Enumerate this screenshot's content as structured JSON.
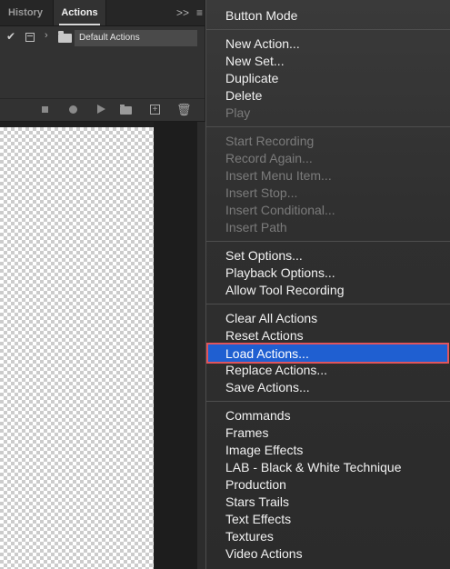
{
  "panel": {
    "tabs": [
      {
        "label": "History"
      },
      {
        "label": "Actions"
      }
    ],
    "collapse_glyph": ">>",
    "menu_glyph": "≡",
    "action_set": {
      "checked": "✔",
      "name": "Default Actions"
    },
    "toolbar_icons": [
      "stop-icon",
      "record-icon",
      "play-icon",
      "folder-icon",
      "new-action-icon",
      "trash-icon"
    ]
  },
  "menu": {
    "groups": [
      {
        "items": [
          {
            "label": "Button Mode",
            "enabled": true
          }
        ]
      },
      {
        "items": [
          {
            "label": "New Action...",
            "enabled": true
          },
          {
            "label": "New Set...",
            "enabled": true
          },
          {
            "label": "Duplicate",
            "enabled": true
          },
          {
            "label": "Delete",
            "enabled": true
          },
          {
            "label": "Play",
            "enabled": false
          }
        ]
      },
      {
        "items": [
          {
            "label": "Start Recording",
            "enabled": false
          },
          {
            "label": "Record Again...",
            "enabled": false
          },
          {
            "label": "Insert Menu Item...",
            "enabled": false
          },
          {
            "label": "Insert Stop...",
            "enabled": false
          },
          {
            "label": "Insert Conditional...",
            "enabled": false
          },
          {
            "label": "Insert Path",
            "enabled": false
          }
        ]
      },
      {
        "items": [
          {
            "label": "Set Options...",
            "enabled": true
          },
          {
            "label": "Playback Options...",
            "enabled": true
          },
          {
            "label": "Allow Tool Recording",
            "enabled": true
          }
        ]
      },
      {
        "items": [
          {
            "label": "Clear All Actions",
            "enabled": true
          },
          {
            "label": "Reset Actions",
            "enabled": true
          },
          {
            "label": "Load Actions...",
            "enabled": true,
            "highlighted": true
          },
          {
            "label": "Replace Actions...",
            "enabled": true
          },
          {
            "label": "Save Actions...",
            "enabled": true
          }
        ]
      },
      {
        "items": [
          {
            "label": "Commands",
            "enabled": true
          },
          {
            "label": "Frames",
            "enabled": true
          },
          {
            "label": "Image Effects",
            "enabled": true
          },
          {
            "label": "LAB - Black & White Technique",
            "enabled": true
          },
          {
            "label": "Production",
            "enabled": true
          },
          {
            "label": "Stars Trails",
            "enabled": true
          },
          {
            "label": "Text Effects",
            "enabled": true
          },
          {
            "label": "Textures",
            "enabled": true
          },
          {
            "label": "Video Actions",
            "enabled": true
          }
        ]
      }
    ],
    "highlight_color": "#1f5fd1",
    "highlight_border_color": "#e0555c"
  }
}
